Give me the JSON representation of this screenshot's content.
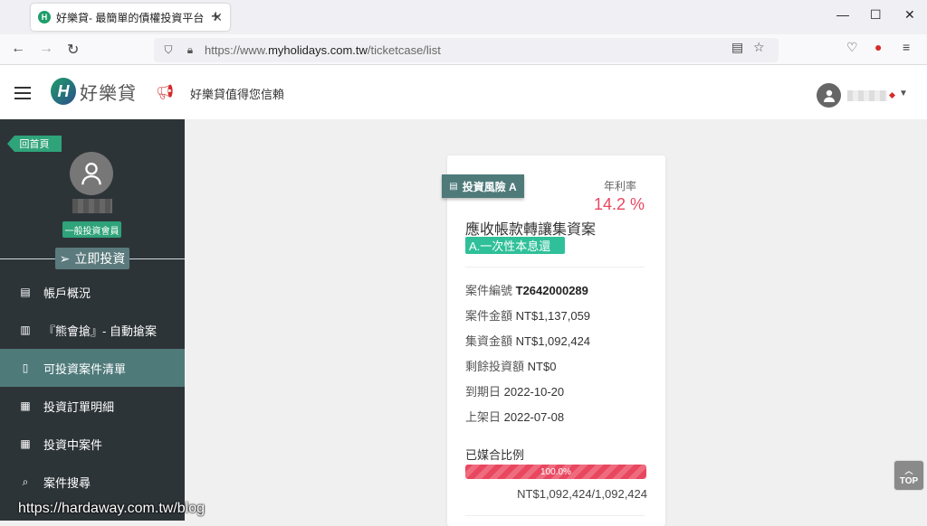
{
  "browser": {
    "tab_title": "好樂貸- 最簡單的債權投資平台",
    "favicon_letter": "H",
    "url_prefix": "https://www.",
    "url_domain": "myholidays.com.tw",
    "url_path": "/ticketcase/list"
  },
  "header": {
    "logo_text": "好樂貸",
    "slogan": "好樂貸值得您信賴"
  },
  "sidebar": {
    "home_tag": "回首頁",
    "member_badge": "一般投資會員",
    "invest_now": "立即投資",
    "items": [
      {
        "label": "帳戶概況",
        "icon": "file-icon"
      },
      {
        "label": "『熊會搶』- 自動搶案",
        "icon": "briefcase-icon"
      },
      {
        "label": "可投資案件清單",
        "icon": "clipboard-icon",
        "active": true
      },
      {
        "label": "投資訂單明細",
        "icon": "calendar-icon"
      },
      {
        "label": "投資中案件",
        "icon": "calendar-icon"
      },
      {
        "label": "案件搜尋",
        "icon": "search-icon"
      }
    ]
  },
  "card": {
    "risk_tag": "投資風險 A",
    "rate_label": "年利率",
    "rate_value": "14.2 %",
    "title": "應收帳款轉讓集資案",
    "pay_type": "A.一次性本息還",
    "case_no_label": "案件編號",
    "case_no": "T2642000289",
    "case_amount_label": "案件金額",
    "case_amount": "NT$1,137,059",
    "raised_label": "集資金額",
    "raised": "NT$1,092,424",
    "remaining_label": "剩餘投資額",
    "remaining": "NT$0",
    "due_label": "到期日",
    "due": "2022-10-20",
    "listed_label": "上架日",
    "listed": "2022-07-08",
    "match_label": "已媒合比例",
    "match_percent_text": "100.0%",
    "match_fraction": 1.0,
    "match_amount": "NT$1,092,424/1,092,424"
  },
  "top_button": "TOP",
  "watermark": "https://hardaway.com.tw/blog",
  "colors": {
    "brand_green": "#2fa37a",
    "sidebar_bg": "#2d3438",
    "active_item": "#4f7a7a",
    "rate_red": "#e8475f"
  }
}
